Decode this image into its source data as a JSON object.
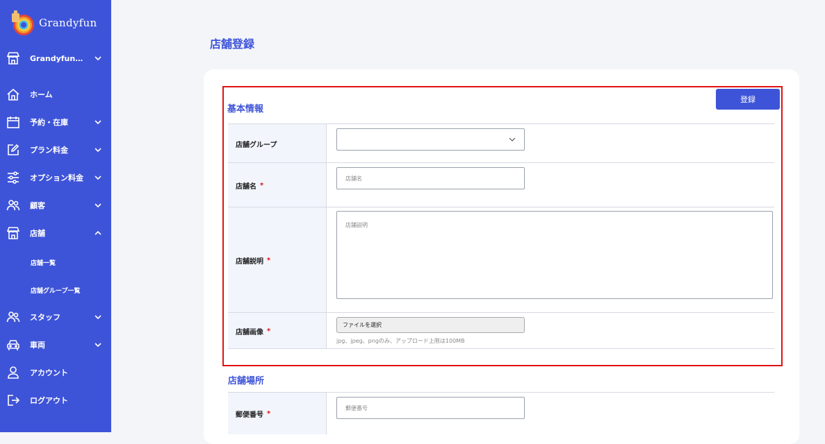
{
  "brand": {
    "name": "Grandyfun"
  },
  "sidebar": {
    "store_selector": "Grandyfun…",
    "items": [
      {
        "label": "ホーム",
        "icon": "home-icon"
      },
      {
        "label": "予約・在庫",
        "icon": "calendar-icon"
      },
      {
        "label": "プラン料金",
        "icon": "edit-icon"
      },
      {
        "label": "オプション料金",
        "icon": "sliders-icon"
      },
      {
        "label": "顧客",
        "icon": "users-icon"
      },
      {
        "label": "店舗",
        "icon": "store-icon"
      },
      {
        "label": "スタッフ",
        "icon": "users-icon"
      },
      {
        "label": "車両",
        "icon": "car-icon"
      },
      {
        "label": "アカウント",
        "icon": "user-icon"
      },
      {
        "label": "ログアウト",
        "icon": "logout-icon"
      }
    ],
    "store_sub": [
      "店舗一覧",
      "店舗グループ一覧"
    ]
  },
  "page": {
    "title": "店舗登録"
  },
  "form": {
    "basic_title": "基本情報",
    "register_button": "登録",
    "group_label": "店舗グループ",
    "name_label": "店舗名",
    "name_placeholder": "店舗名",
    "desc_label": "店舗説明",
    "desc_placeholder": "店舗説明",
    "image_label": "店舗画像",
    "file_button": "ファイルを選択",
    "image_hint": "jpg、jpeg、pngのみ、アップロード上限は100MB",
    "required_mark": "*",
    "location_title": "店舗場所",
    "postal_label": "郵便番号",
    "postal_placeholder": "郵便番号"
  },
  "colors": {
    "accent": "#3e54d8",
    "required": "#e01010",
    "highlight": "#e01010"
  }
}
